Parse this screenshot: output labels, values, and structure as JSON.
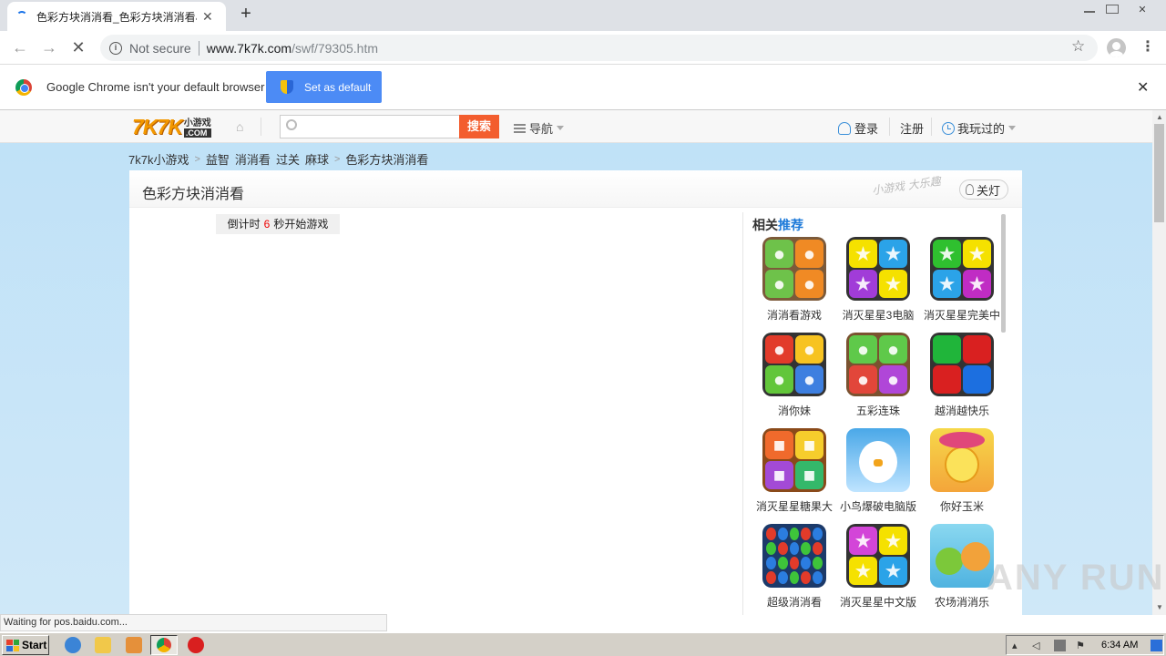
{
  "browser": {
    "tab_title": "色彩方块消消看_色彩方块消消看小游戏",
    "new_tab": "+",
    "tab_close": "✕",
    "security_label": "Not secure",
    "url_host": "www.7k7k.com",
    "url_path": "/swf/79305.htm",
    "infobar_message": "Google Chrome isn't your default browser",
    "set_default_label": "Set as default",
    "status_text": "Waiting for pos.baidu.com..."
  },
  "site": {
    "logo_main": "7K7K",
    "logo_cn": "小游戏",
    "logo_com": ".COM",
    "search_placeholder": "",
    "search_button": "搜索",
    "nav_label": "导航",
    "login_label": "登录",
    "register_label": "注册",
    "played_label": "我玩过的"
  },
  "breadcrumb": [
    "7k7k小游戏",
    "益智",
    "消消看",
    "过关",
    "麻球",
    "色彩方块消消看"
  ],
  "game": {
    "title": "色彩方块消消看",
    "slogan": "小游戏 大乐趣",
    "lights_off": "关灯",
    "countdown_prefix": "倒计时",
    "countdown_value": "6",
    "countdown_suffix": "秒开始游戏"
  },
  "related": {
    "title_prefix": "相关",
    "title_highlight": "推荐",
    "items": [
      {
        "name": "消消看游戏"
      },
      {
        "name": "消灭星星3电脑"
      },
      {
        "name": "消灭星星完美中"
      },
      {
        "name": "消你妹"
      },
      {
        "name": "五彩连珠"
      },
      {
        "name": "越消越快乐"
      },
      {
        "name": "消灭星星糖果大"
      },
      {
        "name": "小鸟爆破电脑版"
      },
      {
        "name": "你好玉米"
      },
      {
        "name": "超级消消看"
      },
      {
        "name": "消灭星星中文版"
      },
      {
        "name": "农场消消乐"
      }
    ]
  },
  "taskbar": {
    "start_label": "Start",
    "clock": "6:34 AM"
  },
  "watermark": "ANY RUN",
  "colors": {
    "accent_blue": "#4c8bf5",
    "search_orange": "#f35d2e",
    "link_blue": "#1d7ad9",
    "countdown_red": "#ee0000"
  }
}
